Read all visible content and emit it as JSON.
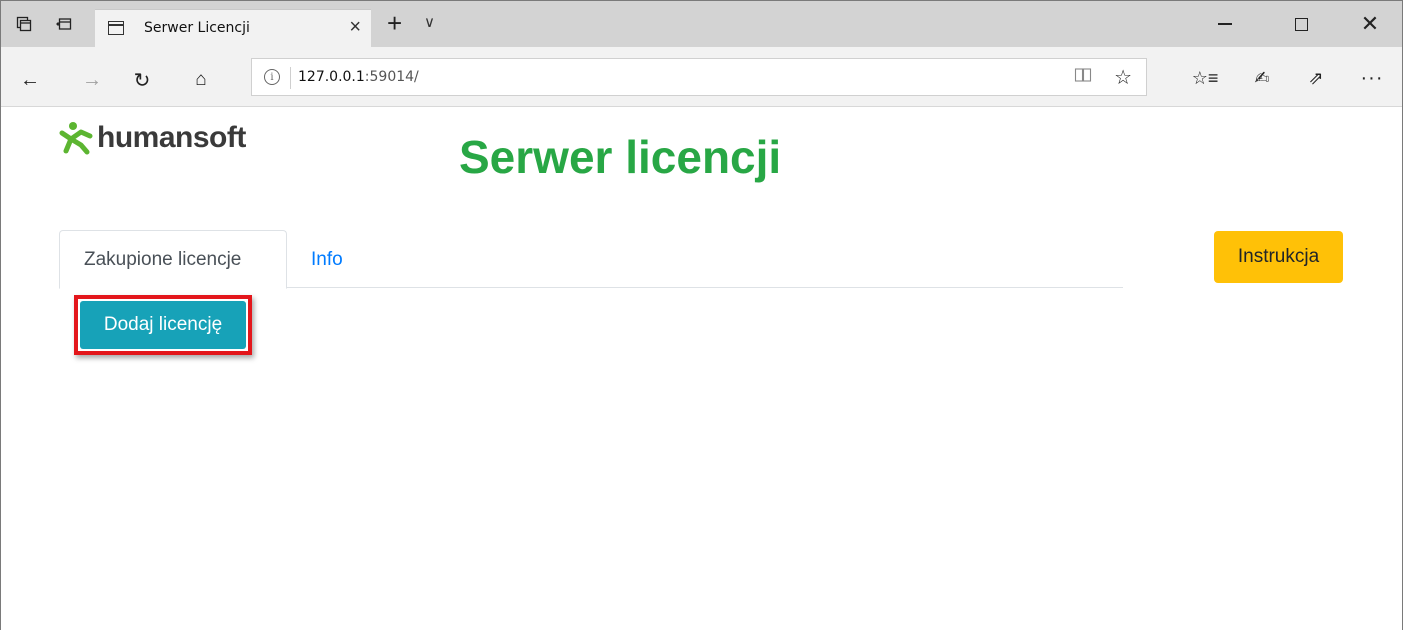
{
  "browser": {
    "tab_title": "Serwer Licencji",
    "tab_close": "×",
    "new_tab": "+",
    "tab_menu": "∨",
    "address_host": "127.0.0.1",
    "address_rest": ":59014/",
    "icons": {
      "set_aside": "set-aside-tabs-icon",
      "tabs_preview": "tab-preview-icon",
      "back": "←",
      "forward": "→",
      "refresh": "↻",
      "home": "⌂",
      "info": "i",
      "reading_view": "📖",
      "favorite": "☆",
      "favorites_list": "☆≡",
      "notes": "✍",
      "share": "⇗",
      "more": "···",
      "close_window": "✕"
    }
  },
  "page": {
    "logo_text": "humansoft",
    "title": "Serwer licencji",
    "tabs": [
      {
        "label": "Zakupione licencje",
        "active": true
      },
      {
        "label": "Info",
        "active": false
      }
    ],
    "instruction_button": "Instrukcja",
    "add_license_button": "Dodaj licencję"
  },
  "colors": {
    "title_green": "#28a745",
    "logo_green": "#5cb531",
    "instruction_yellow": "#ffc107",
    "add_button_teal": "#17a2b8",
    "highlight_red": "#e3161b",
    "link_blue": "#007bff"
  }
}
